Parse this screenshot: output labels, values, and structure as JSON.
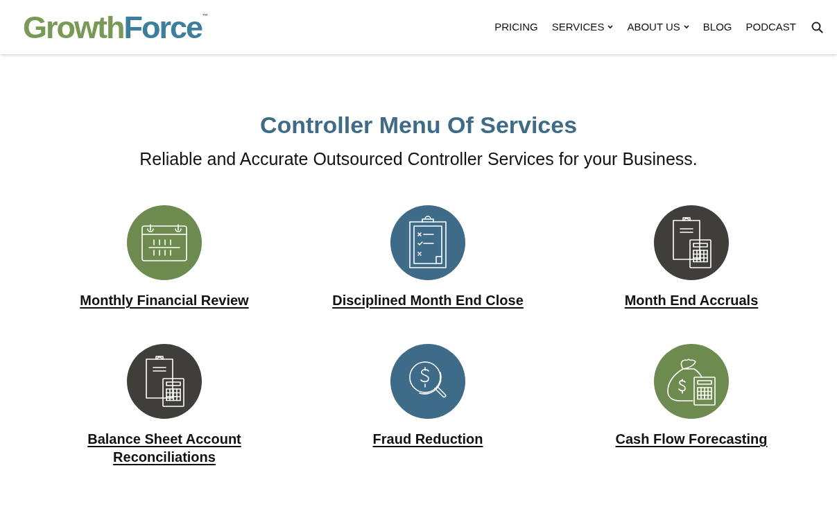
{
  "logo": {
    "parts": [
      {
        "text": "Growth",
        "color": "#789a55"
      },
      {
        "text": "Force",
        "color": "#3b7f9f"
      }
    ],
    "trademark": "™"
  },
  "nav": [
    {
      "label": "PRICING",
      "dropdown": false
    },
    {
      "label": "SERVICES",
      "dropdown": true
    },
    {
      "label": "ABOUT US",
      "dropdown": true
    },
    {
      "label": "BLOG",
      "dropdown": false
    },
    {
      "label": "PODCAST",
      "dropdown": false
    }
  ],
  "heading": "Controller Menu Of Services",
  "subheading": "Reliable and Accurate Outsourced Controller Services for your Business.",
  "services": [
    {
      "title": "Monthly Financial Review",
      "kind": "calendar",
      "color": "#6e8b4f"
    },
    {
      "title": "Disciplined Month End Close",
      "kind": "checklist",
      "color": "#3d6b88"
    },
    {
      "title": "Month End Accruals",
      "kind": "calculator",
      "color": "#403e3a"
    },
    {
      "title": "Balance Sheet Account Reconciliations",
      "kind": "calculator",
      "color": "#403e3a"
    },
    {
      "title": "Fraud Reduction",
      "kind": "magnifier",
      "color": "#3d6b88"
    },
    {
      "title": "Cash Flow Forecasting",
      "kind": "moneybag",
      "color": "#6e8b4f"
    }
  ]
}
